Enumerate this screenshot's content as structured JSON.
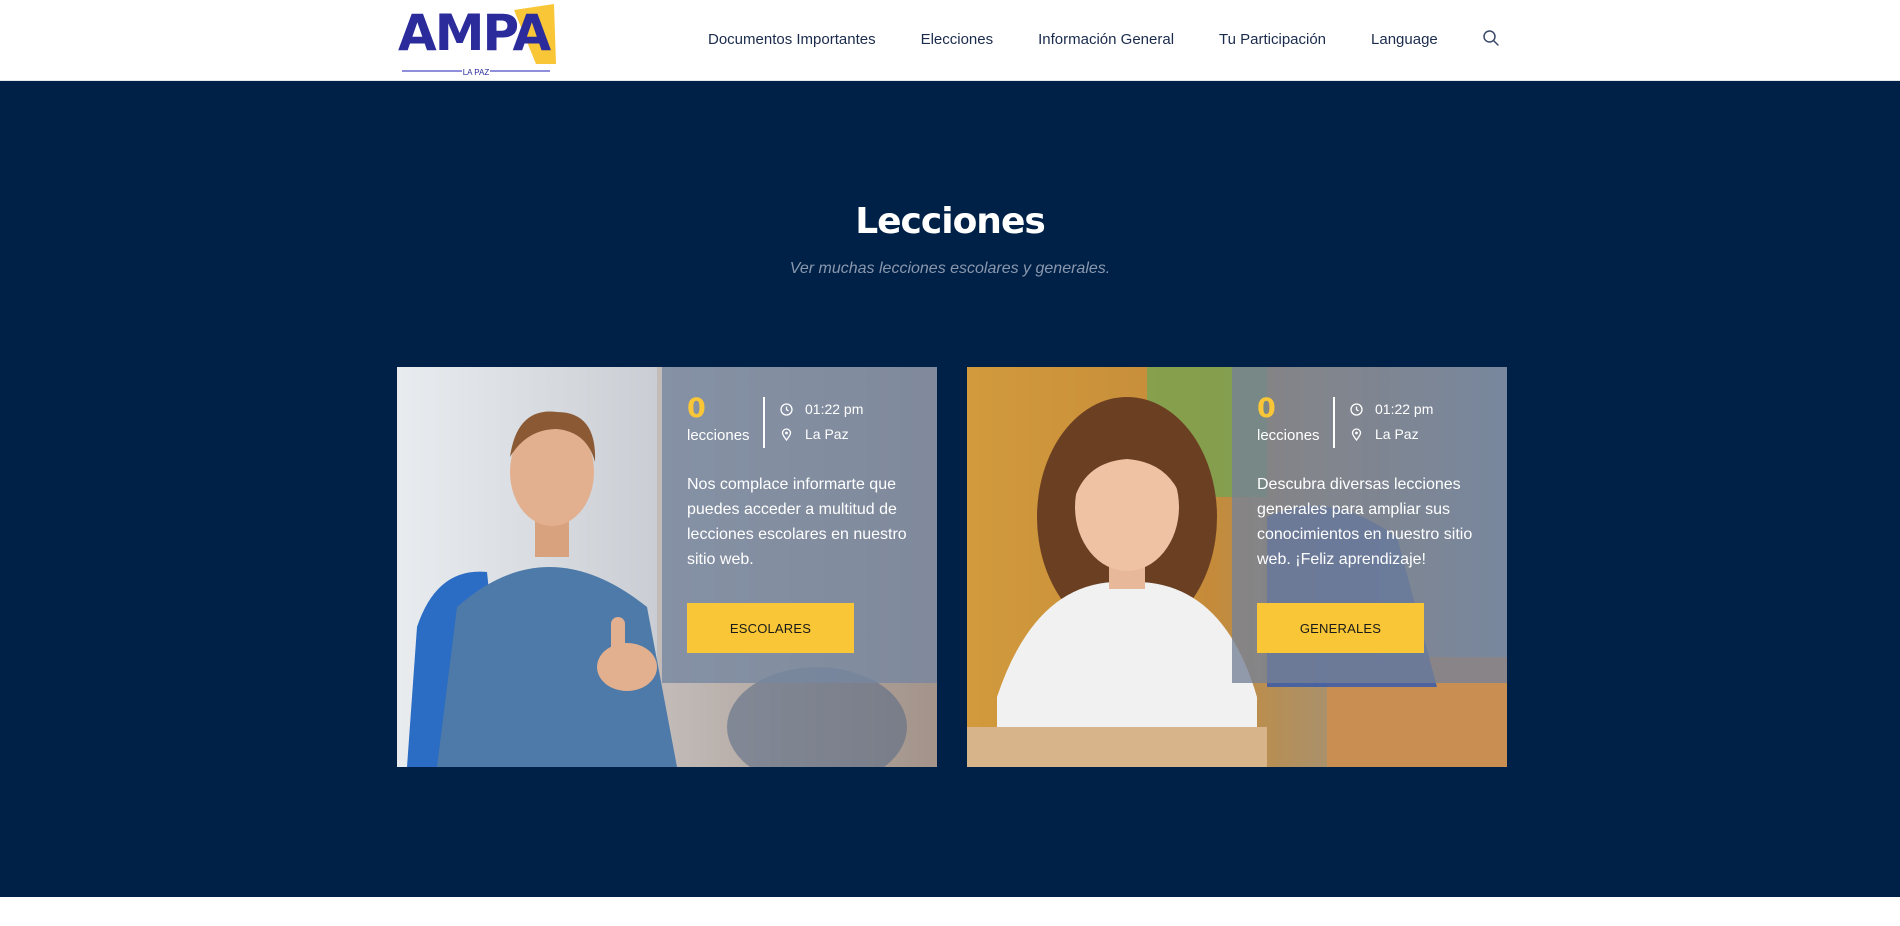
{
  "header": {
    "logo_text": "AMPA",
    "logo_sub": "LA PAZ",
    "nav": [
      "Documentos Importantes",
      "Elecciones",
      "Información General",
      "Tu Participación",
      "Language"
    ]
  },
  "section": {
    "title": "Lecciones",
    "subtitle": "Ver muchas lecciones escolares y generales."
  },
  "cards": [
    {
      "count": "0",
      "count_label": "lecciones",
      "time": "01:22 pm",
      "place": "La Paz",
      "description": "Nos complace informarte que puedes acceder a multitud de lecciones escolares en nuestro sitio web.",
      "button": "ESCOLARES"
    },
    {
      "count": "0",
      "count_label": "lecciones",
      "time": "01:22 pm",
      "place": "La Paz",
      "description": "Descubra diversas lecciones generales para ampliar sus conocimientos en nuestro sitio web. ¡Feliz aprendizaje!",
      "button": "GENERALES"
    }
  ],
  "colors": {
    "navy": "#002147",
    "accent": "#f8c636",
    "logo_blue": "#2b2b9c"
  },
  "icons": [
    "search-icon",
    "clock-icon",
    "map-pin-icon"
  ]
}
